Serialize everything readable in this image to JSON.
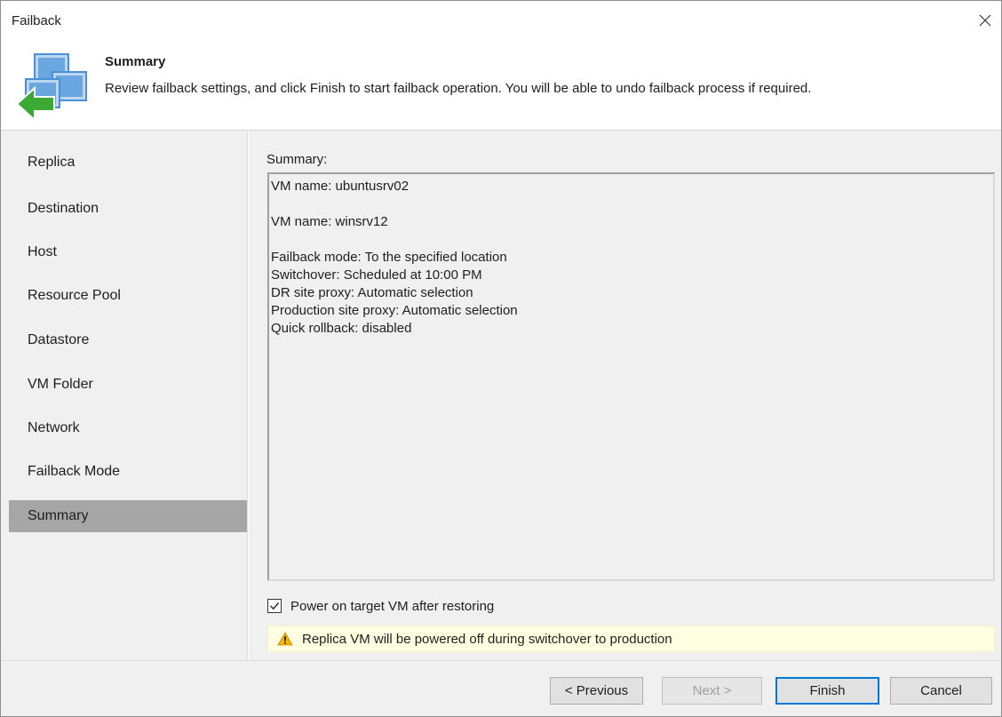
{
  "window": {
    "title": "Failback"
  },
  "header": {
    "title": "Summary",
    "description": "Review failback settings, and click Finish to start failback operation. You will be able to undo failback process if required."
  },
  "sidebar": {
    "items": [
      {
        "label": "Replica"
      },
      {
        "label": "Destination"
      },
      {
        "label": "Host"
      },
      {
        "label": "Resource Pool"
      },
      {
        "label": "Datastore"
      },
      {
        "label": "VM Folder"
      },
      {
        "label": "Network"
      },
      {
        "label": "Failback Mode"
      },
      {
        "label": "Summary",
        "active": true
      }
    ]
  },
  "main": {
    "summary_label": "Summary:",
    "summary_lines": [
      "VM name: ubuntusrv02",
      "",
      "VM name: winsrv12",
      "",
      "Failback mode: To the specified location",
      "Switchover: Scheduled at 10:00 PM",
      "DR site proxy: Automatic selection",
      "Production site proxy: Automatic selection",
      "Quick rollback: disabled"
    ],
    "power_on_checkbox": {
      "label": "Power on target VM after restoring",
      "checked": true
    },
    "warning": {
      "icon": "warning-icon",
      "text": "Replica VM will be powered off during switchover to production"
    }
  },
  "footer": {
    "previous_label": "< Previous",
    "next_label": "Next >",
    "finish_label": "Finish",
    "cancel_label": "Cancel"
  },
  "colors": {
    "panel_bg": "#f0f0f0",
    "active_nav_bg": "#a6a6a6",
    "warning_bg": "#ffffe1",
    "primary_button_border": "#0078d7",
    "icon_green": "#3aaa35",
    "icon_blue": "#4a90d9"
  }
}
